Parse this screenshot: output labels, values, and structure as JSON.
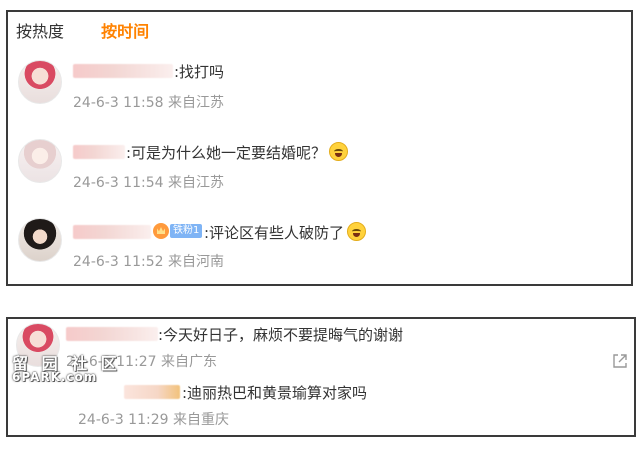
{
  "tabs": [
    {
      "label": "按热度"
    },
    {
      "label": "按时间"
    }
  ],
  "comments": [
    {
      "text": ":找打吗",
      "time": "24-6-3 11:58",
      "location": "来自江苏"
    },
    {
      "text": ":可是为什么她一定要结婚呢？",
      "time": "24-6-3 11:54",
      "location": "来自江苏"
    },
    {
      "text": ":评论区有些人破防了",
      "time": "24-6-3 11:52",
      "location": "来自河南",
      "fan_badge": "铁粉1"
    }
  ],
  "thread": {
    "comment": {
      "text": ":今天好日子，麻烦不要提晦气的谢谢",
      "time": "24-6-3 11:27",
      "location": "来自广东"
    },
    "reply": {
      "text": ":迪丽热巴和黄景瑜算对家吗",
      "time": "24-6-3 11:29",
      "location": "来自重庆"
    }
  },
  "watermark": {
    "line1": "留 园 社 区",
    "line2": "6PARK.com"
  },
  "colors": {
    "accent": "#ff8200",
    "meta": "#999999",
    "border": "#3a3a3a"
  }
}
